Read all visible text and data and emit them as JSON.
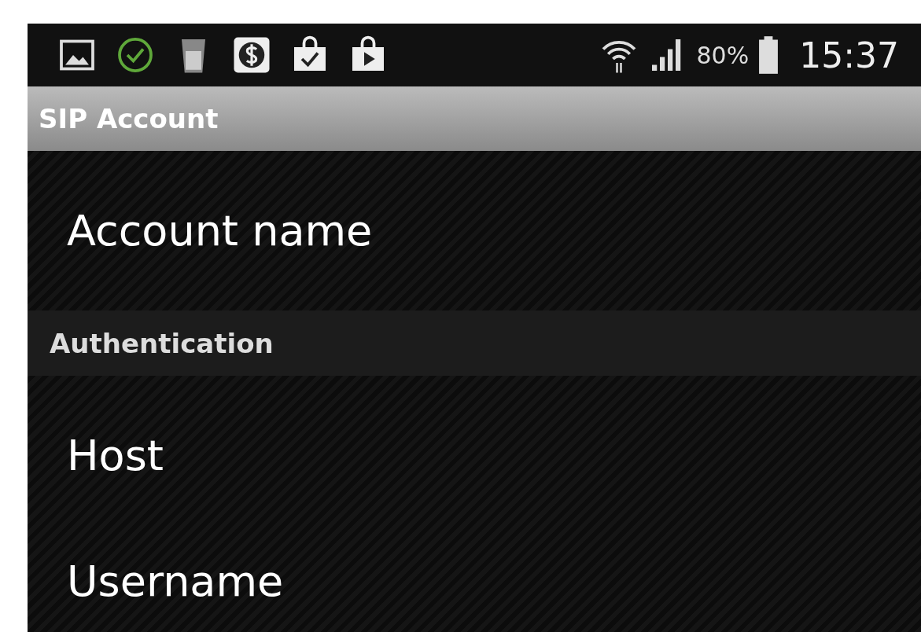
{
  "status_bar": {
    "battery_text": "80%",
    "time": "15:37"
  },
  "title_bar": {
    "title": "SIP Account"
  },
  "preferences": [
    {
      "kind": "item",
      "label": "Account name"
    },
    {
      "kind": "category",
      "label": "Authentication"
    },
    {
      "kind": "item",
      "label": "Host"
    },
    {
      "kind": "item",
      "label": "Username"
    }
  ]
}
